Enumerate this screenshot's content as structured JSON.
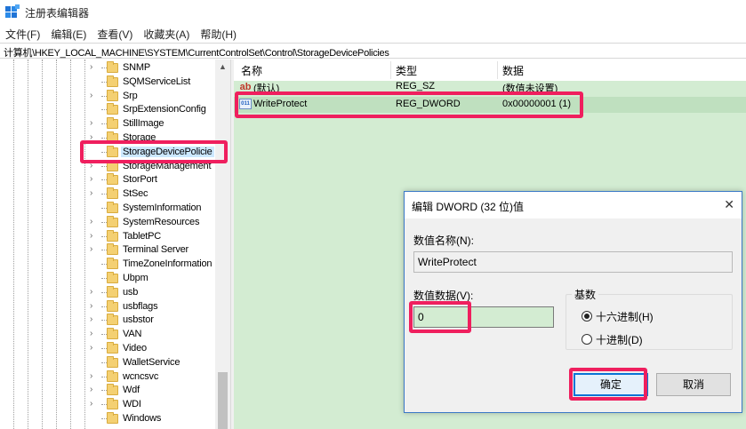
{
  "window": {
    "title": "注册表编辑器",
    "app_icon": "regedit-icon"
  },
  "menu": [
    "文件(F)",
    "编辑(E)",
    "查看(V)",
    "收藏夹(A)",
    "帮助(H)"
  ],
  "address": "计算机\\HKEY_LOCAL_MACHINE\\SYSTEM\\CurrentControlSet\\Control\\StorageDevicePolicies",
  "tree": {
    "items": [
      {
        "label": "SNMP",
        "expander": true
      },
      {
        "label": "SQMServiceList",
        "expander": false
      },
      {
        "label": "Srp",
        "expander": true
      },
      {
        "label": "SrpExtensionConfig",
        "expander": false
      },
      {
        "label": "StillImage",
        "expander": true
      },
      {
        "label": "Storage",
        "expander": true
      },
      {
        "label": "StorageDevicePolicie",
        "expander": false,
        "selected": true
      },
      {
        "label": "StorageManagement",
        "expander": true
      },
      {
        "label": "StorPort",
        "expander": true
      },
      {
        "label": "StSec",
        "expander": true
      },
      {
        "label": "SystemInformation",
        "expander": false
      },
      {
        "label": "SystemResources",
        "expander": true
      },
      {
        "label": "TabletPC",
        "expander": true
      },
      {
        "label": "Terminal Server",
        "expander": true
      },
      {
        "label": "TimeZoneInformation",
        "expander": false
      },
      {
        "label": "Ubpm",
        "expander": false
      },
      {
        "label": "usb",
        "expander": true
      },
      {
        "label": "usbflags",
        "expander": true
      },
      {
        "label": "usbstor",
        "expander": true
      },
      {
        "label": "VAN",
        "expander": true
      },
      {
        "label": "Video",
        "expander": true
      },
      {
        "label": "WalletService",
        "expander": false
      },
      {
        "label": "wcncsvc",
        "expander": true
      },
      {
        "label": "Wdf",
        "expander": true
      },
      {
        "label": "WDI",
        "expander": true
      },
      {
        "label": "Windows",
        "expander": false
      }
    ]
  },
  "values": {
    "headers": {
      "name": "名称",
      "type": "类型",
      "data": "数据"
    },
    "rows": [
      {
        "name": "(默认)",
        "type": "REG_SZ",
        "data": "(数值未设置)",
        "icon": "string-value-icon"
      },
      {
        "name": "WriteProtect",
        "type": "REG_DWORD",
        "data": "0x00000001 (1)",
        "icon": "dword-value-icon"
      }
    ]
  },
  "dialog": {
    "title": "编辑 DWORD (32 位)值",
    "name_label": "数值名称(N):",
    "name_value": "WriteProtect",
    "data_label": "数值数据(V):",
    "data_value": "0",
    "base_label": "基数",
    "hex_label": "十六进制(H)",
    "dec_label": "十进制(D)",
    "hex_selected": true,
    "ok_label": "确定",
    "cancel_label": "取消"
  },
  "colors": {
    "highlight": "#ef1f5e",
    "values_bg": "#d3ecd2",
    "dialog_border": "#3a78c6"
  }
}
